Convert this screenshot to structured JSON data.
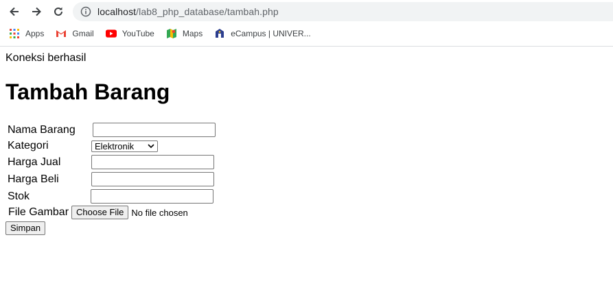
{
  "browser": {
    "url_host": "localhost",
    "url_path": "/lab8_php_database/tambah.php",
    "icons": {
      "back": "arrow-left-icon",
      "forward": "arrow-right-icon",
      "reload": "reload-icon",
      "info": "info-icon"
    },
    "bookmarks": [
      {
        "label": "Apps",
        "icon": "apps-grid-icon"
      },
      {
        "label": "Gmail",
        "icon": "gmail-icon"
      },
      {
        "label": "YouTube",
        "icon": "youtube-icon"
      },
      {
        "label": "Maps",
        "icon": "maps-icon"
      },
      {
        "label": "eCampus | UNIVER...",
        "icon": "ecampus-icon"
      }
    ]
  },
  "page": {
    "status": "Koneksi berhasil",
    "title": "Tambah Barang",
    "form": {
      "nama_label": "Nama Barang",
      "nama_value": "",
      "kategori_label": "Kategori",
      "kategori_value": "Elektronik",
      "harga_jual_label": "Harga Jual",
      "harga_jual_value": "",
      "harga_beli_label": "Harga Beli",
      "harga_beli_value": "",
      "stok_label": "Stok",
      "stok_value": "",
      "file_label": "File Gambar",
      "file_button": "Choose File",
      "file_status": "No file chosen",
      "submit": "Simpan"
    }
  },
  "colors": {
    "omnibox_bg": "#f1f3f4",
    "youtube_red": "#ff0000",
    "gmail_red": "#ea4335"
  }
}
